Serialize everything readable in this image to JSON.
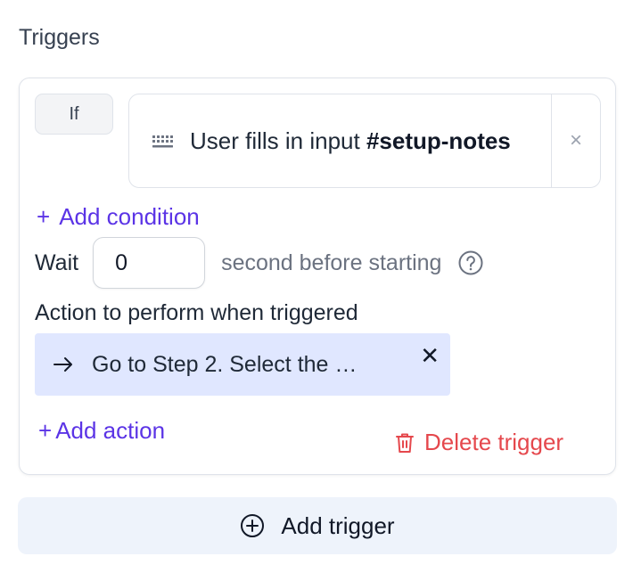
{
  "section": {
    "title": "Triggers"
  },
  "trigger": {
    "if_label": "If",
    "condition": {
      "icon": "keyboard-icon",
      "text_prefix": "User fills in input ",
      "text_target": "#setup-notes",
      "close_glyph": "×"
    },
    "add_condition_label": "Add condition",
    "wait": {
      "label": "Wait",
      "value": "0",
      "suffix": "second before starting"
    },
    "action_heading": "Action to perform when triggered",
    "action": {
      "icon": "arrow-right-icon",
      "text": "Go to Step 2. Select the …",
      "close_glyph": "✕"
    },
    "add_action_label": "Add action",
    "delete_label": "Delete trigger"
  },
  "add_trigger_label": "Add trigger",
  "colors": {
    "accent": "#5b34e6",
    "danger": "#e5484d",
    "chip_bg": "#e0e7ff",
    "button_bg": "#eef3fb"
  }
}
